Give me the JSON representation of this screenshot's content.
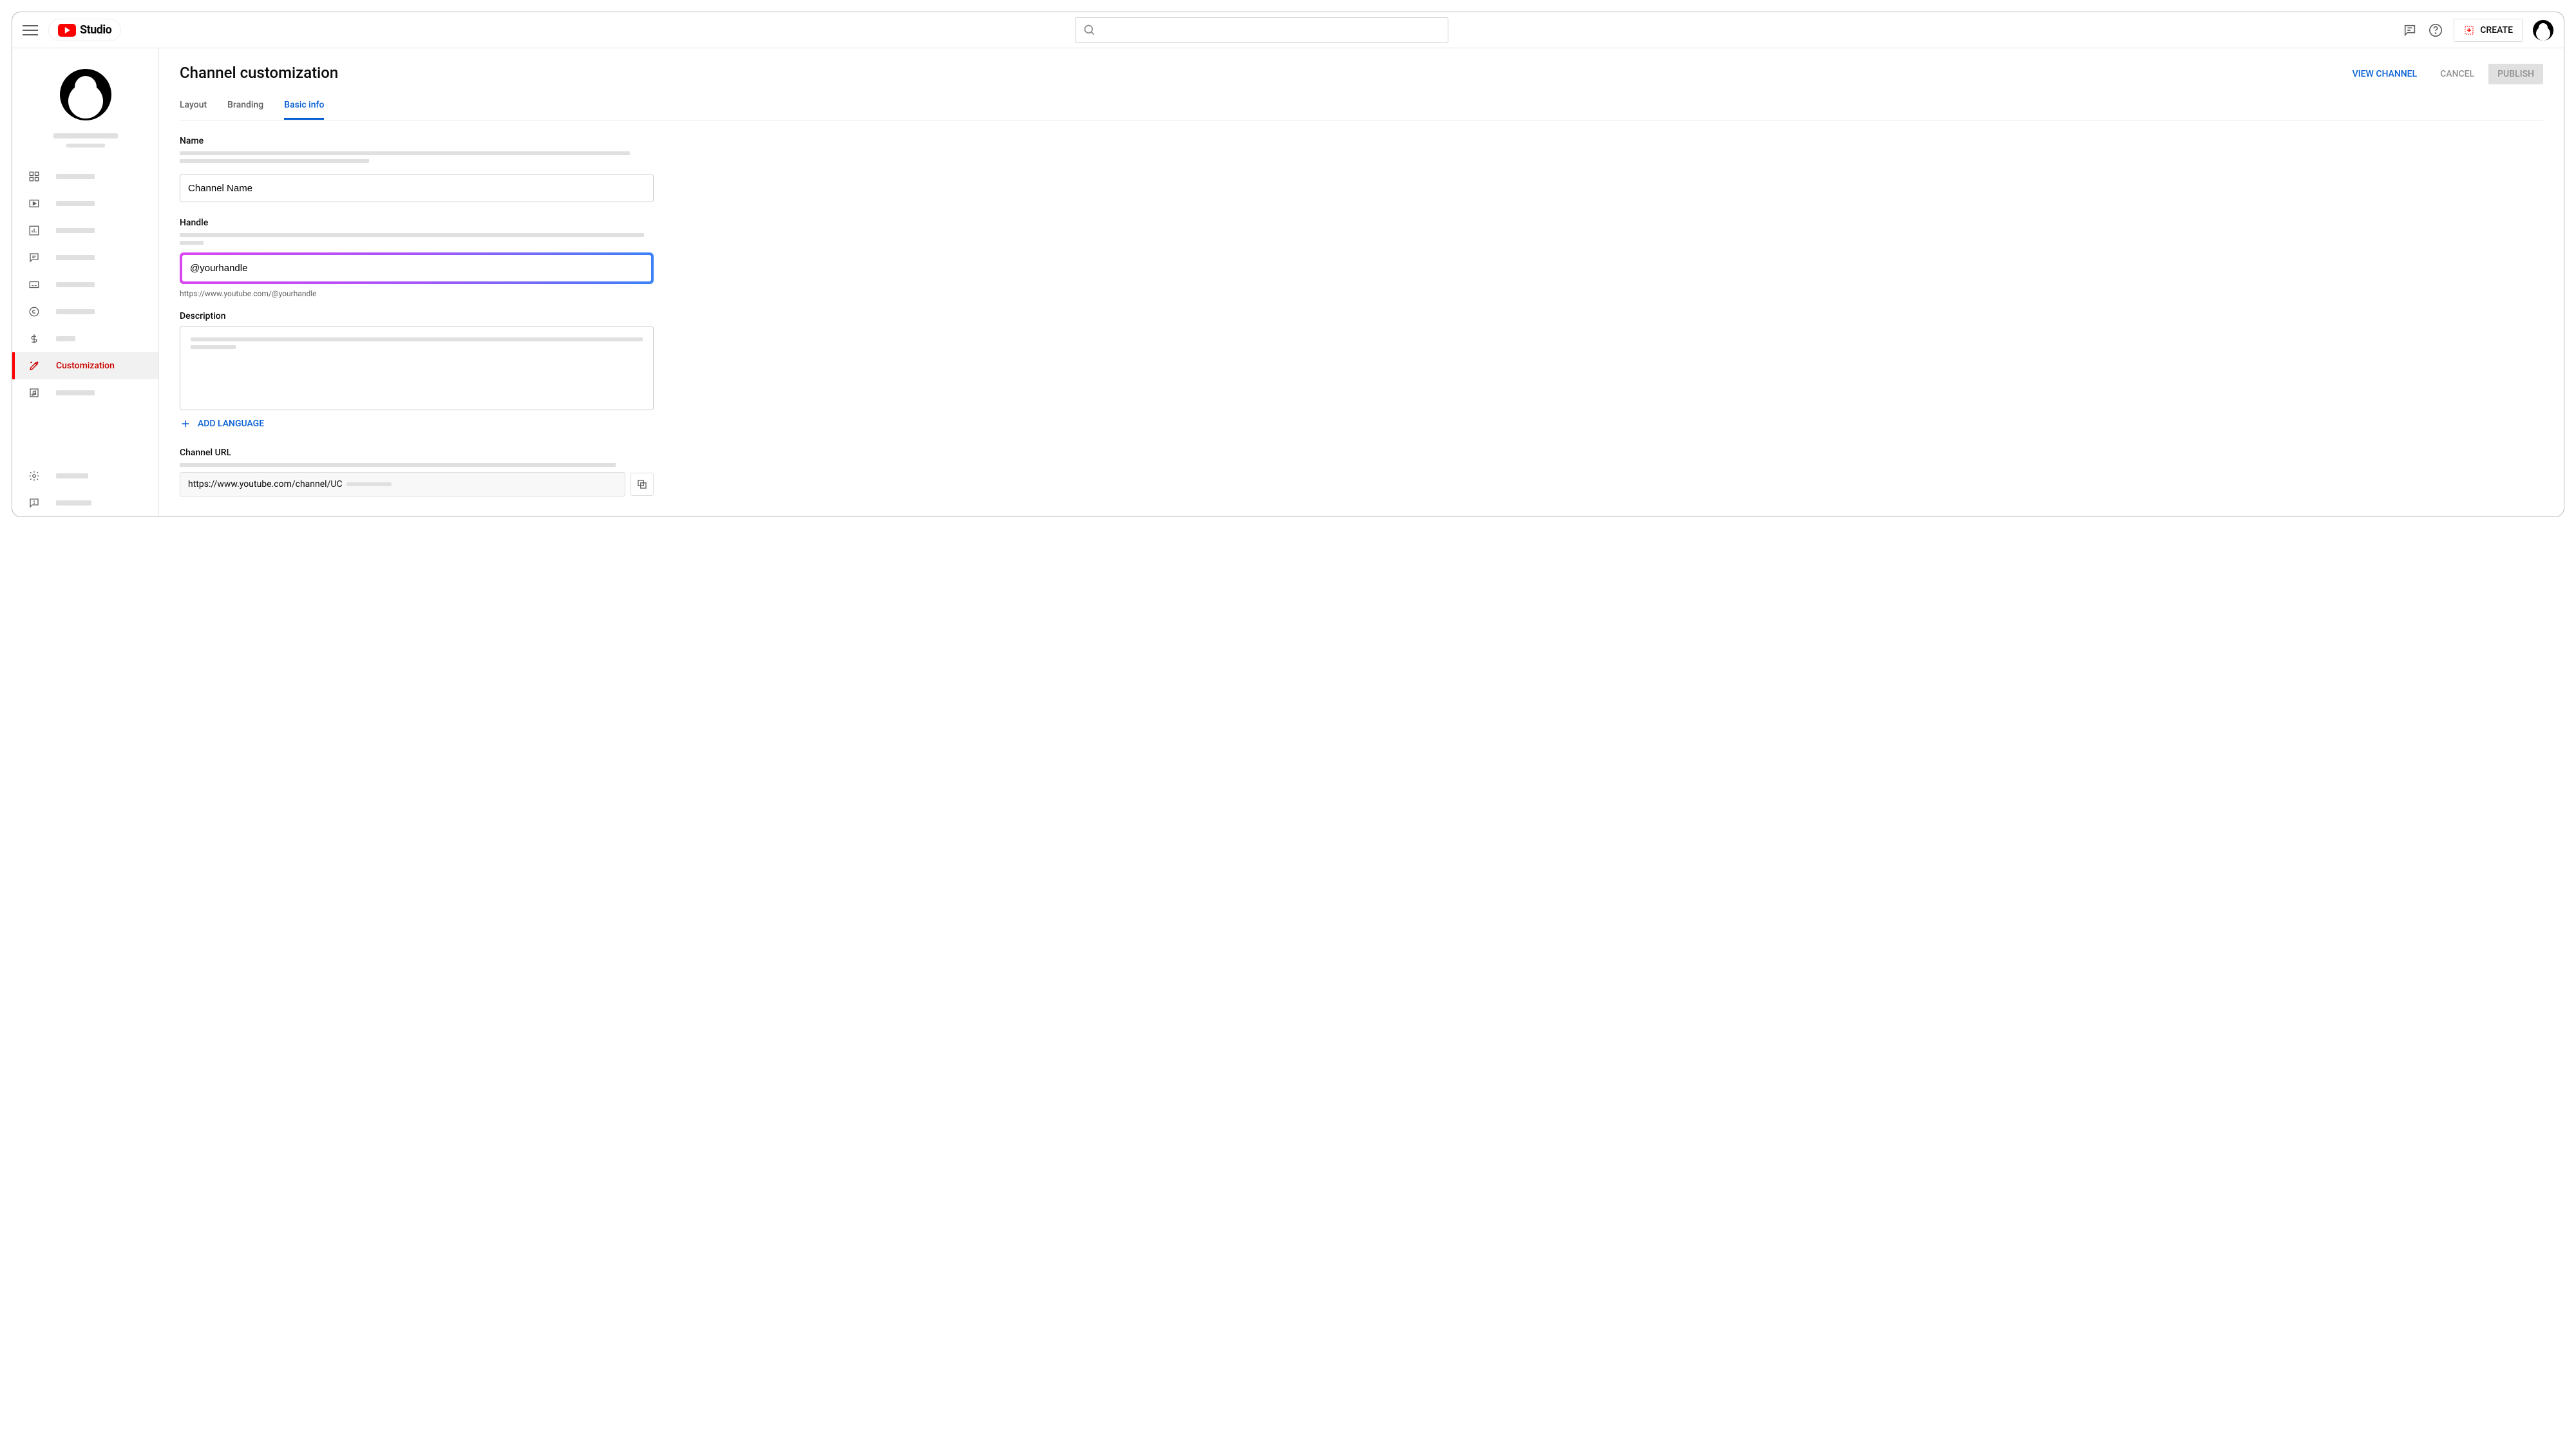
{
  "header": {
    "logo_text": "Studio",
    "create_label": "CREATE"
  },
  "sidebar": {
    "active_label": "Customization"
  },
  "page": {
    "title": "Channel customization",
    "tabs": [
      "Layout",
      "Branding",
      "Basic info"
    ],
    "active_tab": 2,
    "actions": {
      "view_channel": "VIEW CHANNEL",
      "cancel": "CANCEL",
      "publish": "PUBLISH"
    }
  },
  "form": {
    "name_label": "Name",
    "name_value": "Channel Name",
    "handle_label": "Handle",
    "handle_value": "@yourhandle",
    "handle_url": "https://www.youtube.com/@yourhandle",
    "description_label": "Description",
    "add_language": "ADD LANGUAGE",
    "channel_url_label": "Channel URL",
    "channel_url_value": "https://www.youtube.com/channel/UC"
  }
}
